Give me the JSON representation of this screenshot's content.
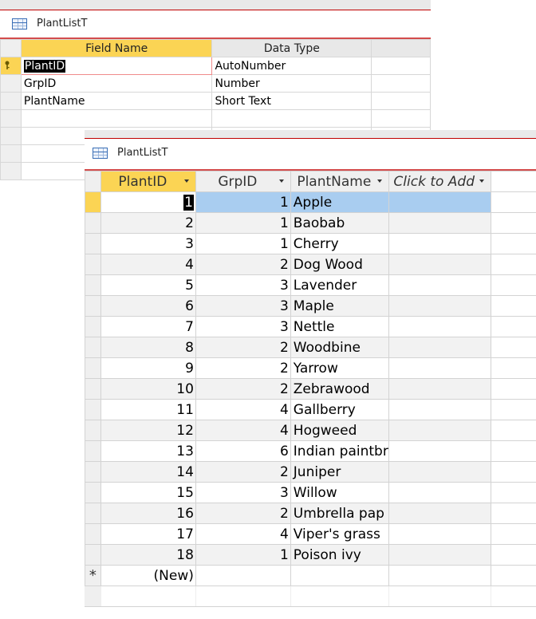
{
  "design_view": {
    "tab_title": "PlantListT",
    "headers": {
      "field_name": "Field Name",
      "data_type": "Data Type"
    },
    "fields": [
      {
        "name": "PlantID",
        "type": "AutoNumber"
      },
      {
        "name": "GrpID",
        "type": "Number"
      },
      {
        "name": "PlantName",
        "type": "Short Text"
      }
    ]
  },
  "datasheet": {
    "tab_title": "PlantListT",
    "columns": {
      "plant_id": "PlantID",
      "grp_id": "GrpID",
      "plant_name": "PlantName",
      "add": "Click to Add"
    },
    "rows": [
      {
        "id": "1",
        "grp": "1",
        "name": "Apple"
      },
      {
        "id": "2",
        "grp": "1",
        "name": "Baobab"
      },
      {
        "id": "3",
        "grp": "1",
        "name": "Cherry"
      },
      {
        "id": "4",
        "grp": "2",
        "name": "Dog Wood"
      },
      {
        "id": "5",
        "grp": "3",
        "name": "Lavender"
      },
      {
        "id": "6",
        "grp": "3",
        "name": "Maple"
      },
      {
        "id": "7",
        "grp": "3",
        "name": "Nettle"
      },
      {
        "id": "8",
        "grp": "2",
        "name": "Woodbine"
      },
      {
        "id": "9",
        "grp": "2",
        "name": "Yarrow"
      },
      {
        "id": "10",
        "grp": "2",
        "name": "Zebrawood"
      },
      {
        "id": "11",
        "grp": "4",
        "name": "Gallberry"
      },
      {
        "id": "12",
        "grp": "4",
        "name": "Hogweed"
      },
      {
        "id": "13",
        "grp": "6",
        "name": "Indian paintbr"
      },
      {
        "id": "14",
        "grp": "2",
        "name": "Juniper"
      },
      {
        "id": "15",
        "grp": "3",
        "name": "Willow"
      },
      {
        "id": "16",
        "grp": "2",
        "name": "Umbrella pap"
      },
      {
        "id": "17",
        "grp": "4",
        "name": "Viper's grass"
      },
      {
        "id": "18",
        "grp": "1",
        "name": "Poison ivy"
      }
    ],
    "new_row": {
      "marker": "*",
      "label": "(New)"
    }
  }
}
